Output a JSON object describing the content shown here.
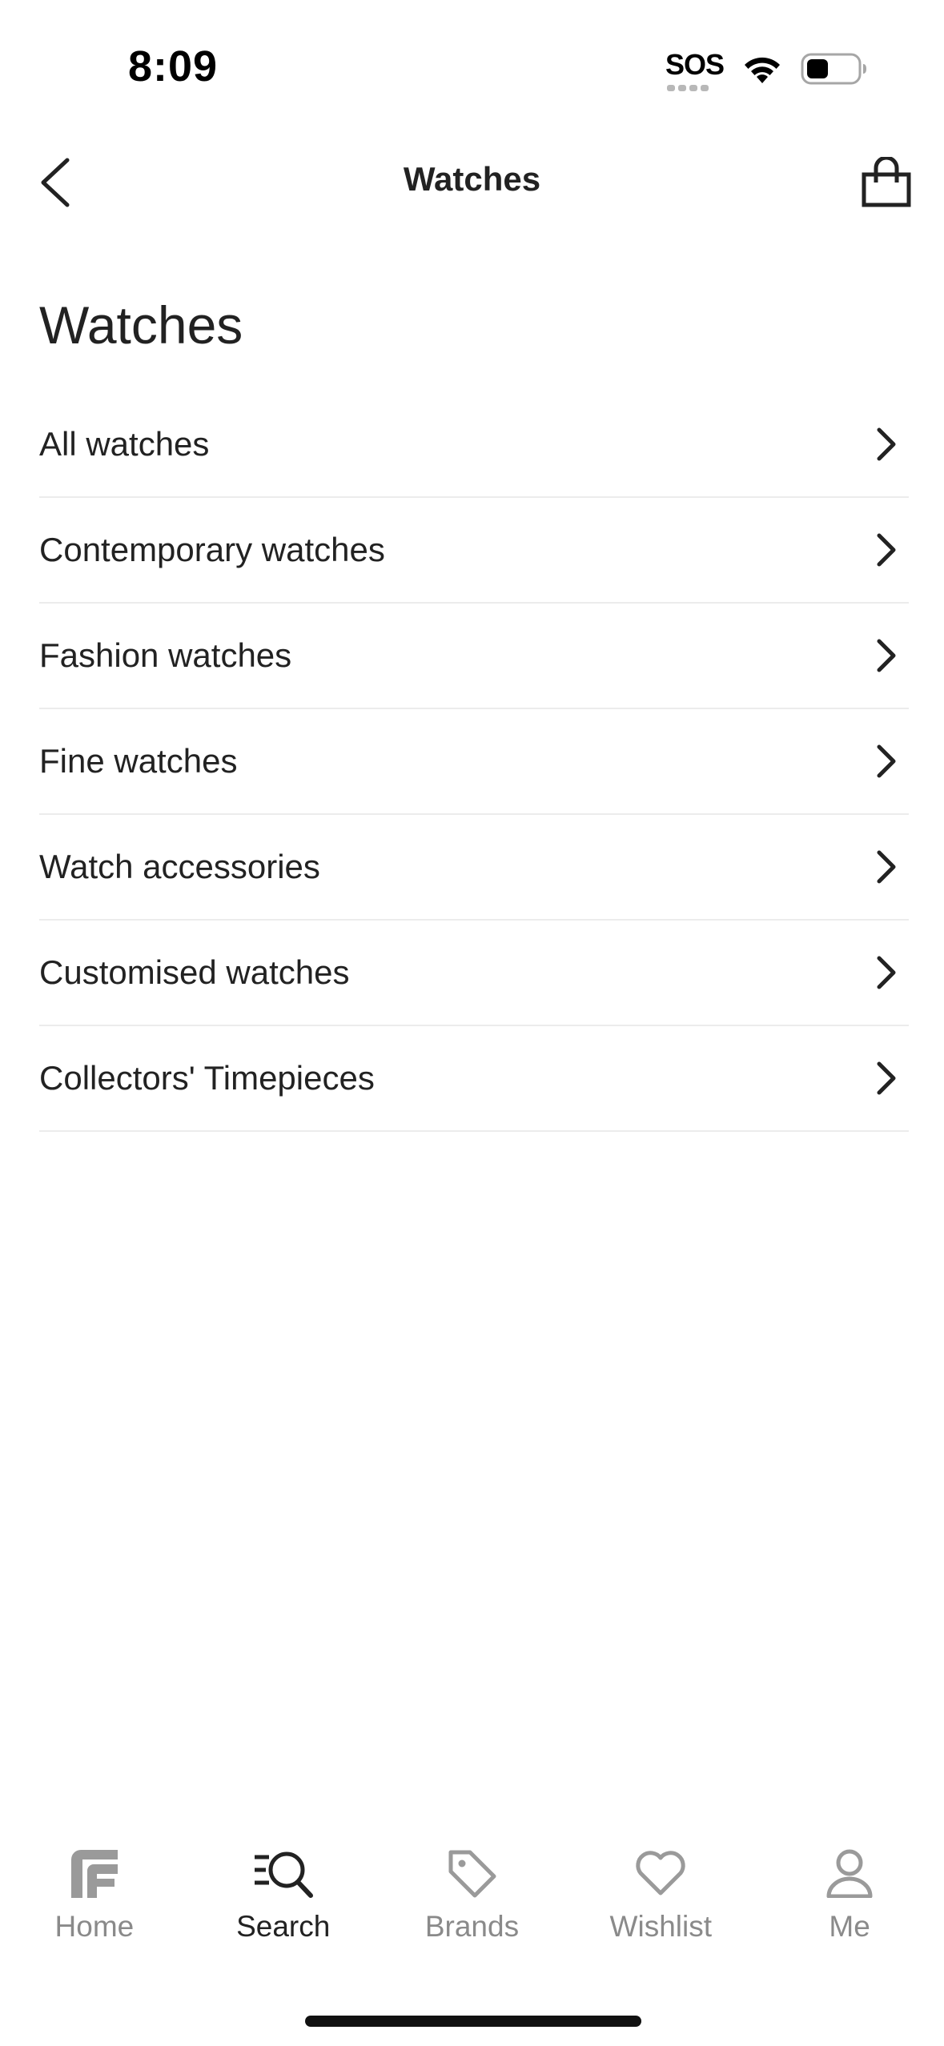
{
  "status_bar": {
    "time": "8:09",
    "sos_label": "SOS",
    "icons": [
      "wifi-icon",
      "battery-icon"
    ]
  },
  "nav": {
    "title": "Watches",
    "back_icon": "chevron-left-icon",
    "bag_icon": "shopping-bag-icon"
  },
  "section": {
    "heading": "Watches"
  },
  "menu": {
    "items": [
      {
        "label": "All watches"
      },
      {
        "label": "Contemporary watches"
      },
      {
        "label": "Fashion watches"
      },
      {
        "label": "Fine watches"
      },
      {
        "label": "Watch accessories"
      },
      {
        "label": "Customised watches"
      },
      {
        "label": "Collectors' Timepieces"
      }
    ]
  },
  "tabs": {
    "items": [
      {
        "label": "Home",
        "icon": "ff-logo-icon",
        "active": false
      },
      {
        "label": "Search",
        "icon": "search-icon",
        "active": true
      },
      {
        "label": "Brands",
        "icon": "tag-icon",
        "active": false
      },
      {
        "label": "Wishlist",
        "icon": "heart-icon",
        "active": false
      },
      {
        "label": "Me",
        "icon": "user-icon",
        "active": false
      }
    ]
  },
  "colors": {
    "text": "#222222",
    "inactive": "#8a8a8a",
    "divider": "#ececec",
    "background": "#ffffff"
  }
}
